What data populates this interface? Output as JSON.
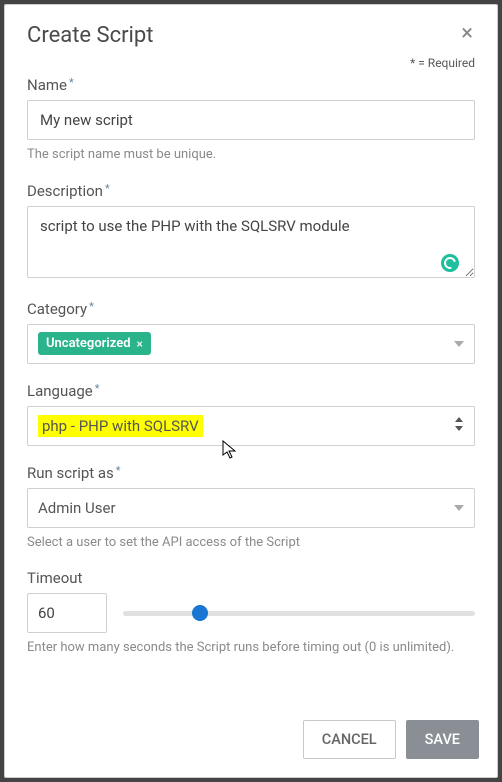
{
  "modal": {
    "title": "Create Script",
    "required_legend": "* = Required",
    "close_glyph": "×"
  },
  "fields": {
    "name": {
      "label": "Name",
      "value": "My new script",
      "help": "The script name must be unique."
    },
    "description": {
      "label": "Description",
      "value": "script to use the PHP with the SQLSRV module"
    },
    "category": {
      "label": "Category",
      "tag": "Uncategorized",
      "tag_close": "×"
    },
    "language": {
      "label": "Language",
      "value": "php - PHP with SQLSRV"
    },
    "run_as": {
      "label": "Run script as",
      "value": "Admin User",
      "help": "Select a user to set the API access of the Script"
    },
    "timeout": {
      "label": "Timeout",
      "value": "60",
      "help": "Enter how many seconds the Script runs before timing out (0 is unlimited)."
    }
  },
  "buttons": {
    "cancel": "CANCEL",
    "save": "SAVE"
  }
}
